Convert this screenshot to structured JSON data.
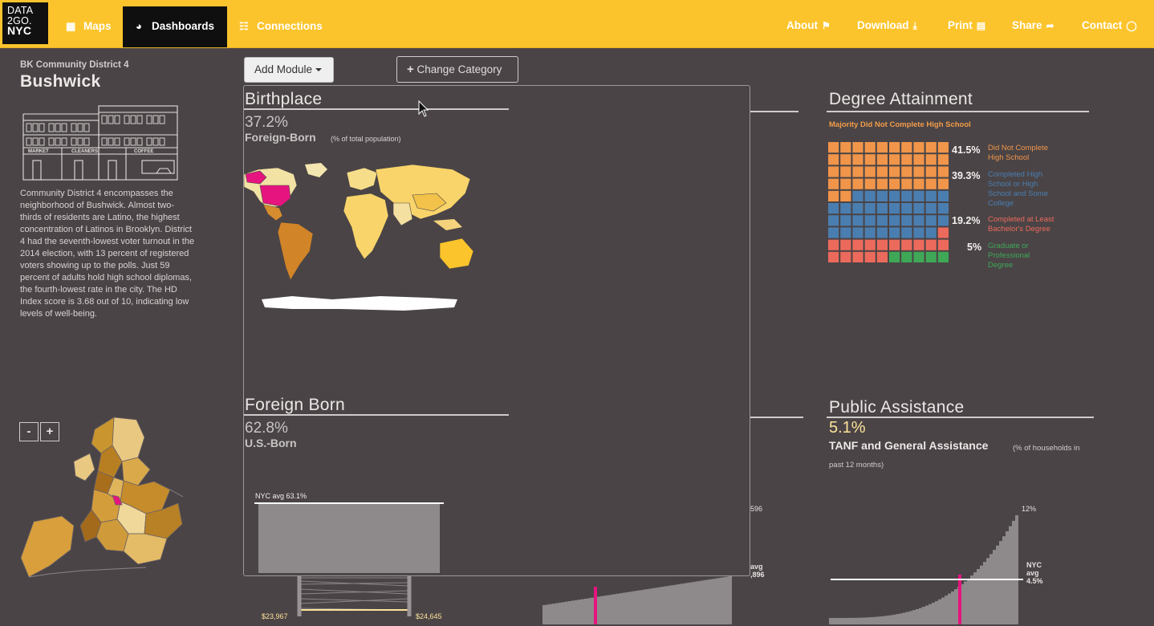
{
  "nav": {
    "logo_lines": [
      "DATA",
      "2GO.",
      "NYC"
    ],
    "items": [
      {
        "label": "Maps",
        "icon": "map-icon"
      },
      {
        "label": "Dashboards",
        "icon": "pie-chart-icon"
      },
      {
        "label": "Connections",
        "icon": "sitemap-icon"
      }
    ],
    "right": [
      {
        "label": "About",
        "icon": "flag-icon"
      },
      {
        "label": "Download",
        "icon": "download-icon"
      },
      {
        "label": "Print",
        "icon": "document-icon"
      },
      {
        "label": "Share",
        "icon": "share-icon"
      },
      {
        "label": "Contact",
        "icon": "speech-bubble-icon"
      }
    ]
  },
  "sidebar": {
    "district": "BK Community District 4",
    "name": "Bushwick",
    "store_signs": [
      "MARKET",
      "CLEANERS",
      "COFFEE"
    ],
    "description": "Community District 4 encompasses the neighborhood of Bushwick. Almost two-thirds of residents are Latino, the highest concentration of Latinos in Brooklyn. District 4 had the seventh-lowest voter turnout in the 2014 election, with 13 percent of registered voters showing up to the polls. Just 59 percent of adults hold high school diplomas, the fourth-lowest rate in the city. The HD Index score is 3.68 out of 10, indicating low levels of well-being.",
    "zoom_out": "-",
    "zoom_in": "+"
  },
  "toolbar": {
    "add_module": "Add Module",
    "change_category": "Change Category",
    "change_icon": "plus-icon"
  },
  "degree": {
    "title": "Degree Attainment",
    "note": "Majority Did Not Complete High School",
    "rows": [
      {
        "pct": "41.5%",
        "label": "Did Not Complete High School",
        "color": "#f0954a"
      },
      {
        "pct": "39.3%",
        "label": "Completed High School or High School and Some College",
        "color": "#4b7eb0"
      },
      {
        "pct": "19.2%",
        "label": "Completed at Least Bachelor's Degree",
        "color": "#ec6a5c"
      },
      {
        "pct": "5%",
        "label": "Graduate or Professional Degree",
        "color": "#3fa857"
      }
    ]
  },
  "public_assistance": {
    "title": "Public Assistance",
    "pct": "5.1%",
    "label": "TANF and General Assistance",
    "note": "(% of households in past 12 months)",
    "max_label": "12%",
    "avg_label": [
      "NYC",
      "avg",
      "4.5%"
    ]
  },
  "income": {
    "left_value": "$23,967",
    "right_value": "$24,645",
    "partial_top": "596",
    "partial_avg": [
      "avg",
      ",896"
    ]
  },
  "panel": {
    "birthplace": {
      "title": "Birthplace",
      "pct": "37.2%",
      "label": "Foreign-Born",
      "note": "(% of total population)"
    },
    "foreign_born": {
      "title": "Foreign Born",
      "pct": "62.8%",
      "label": "U.S.-Born",
      "avg_label": "NYC avg 63.1%"
    }
  },
  "colors": {
    "nav": "#fcc42c",
    "background": "#4a4446",
    "highlight": "#e6147f"
  }
}
